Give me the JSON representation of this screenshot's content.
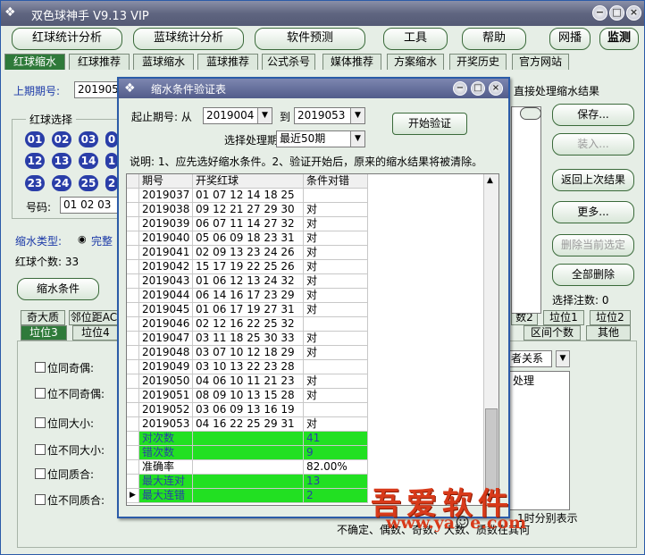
{
  "app": {
    "title": "双色球神手 V9.13 VIP"
  },
  "toolbar": [
    "红球统计分析",
    "蓝球统计分析",
    "软件预测",
    "工具",
    "帮助",
    "网播",
    "监测"
  ],
  "tabs": [
    "红球缩水",
    "红球推荐",
    "蓝球缩水",
    "蓝球推荐",
    "公式杀号",
    "媒体推荐",
    "方案缩水",
    "开奖历史",
    "官方网站"
  ],
  "main": {
    "last_period_label": "上期期号:",
    "last_period_value": "201905",
    "direct_result_label": "直接处理缩水结果",
    "red_select_label": "红球选择",
    "balls_row1": [
      "01",
      "02",
      "03",
      "0"
    ],
    "balls_row2": [
      "12",
      "13",
      "14",
      "1"
    ],
    "balls_row3": [
      "23",
      "24",
      "25",
      "2"
    ],
    "number_label": "号码:",
    "number_value": "01 02 03",
    "shrink_type_label": "缩水类型:",
    "shrink_type_value": "完整",
    "red_count_label": "红球个数: 33",
    "condition_button": "缩水条件",
    "select_count_label": "选择注数: 0",
    "right_buttons": [
      "保存...",
      "装入...",
      "返回上次结果",
      "更多...",
      "删除当前选定",
      "全部删除"
    ],
    "tabs_row1": [
      "奇大质",
      "邻位距AC"
    ],
    "tabs_row2": [
      "垃位3",
      "垃位4"
    ],
    "tabs_right_row1": [
      "数2",
      "垃位1",
      "垃位2"
    ],
    "tabs_right_row2": [
      "区间个数",
      "其他"
    ],
    "checks": [
      "位同奇偶:",
      "位不同奇偶:",
      "位同大小:",
      "位不同大小:",
      "位同质合:",
      "位不同质合:"
    ],
    "relation_value": "者关系",
    "process_label": "处理",
    "note1": "1时分别表示",
    "note2": "不确定、偶数、奇数、大数、质数在其何"
  },
  "dialog": {
    "title": "缩水条件验证表",
    "range_label": "起止期号: 从",
    "from_value": "2019004",
    "to_label": "到",
    "to_value": "2019053",
    "periods_label": "选择处理期数:",
    "periods_value": "最近50期",
    "start_button": "开始验证",
    "note": "说明: 1、应先选好缩水条件。2、验证开始后，原来的缩水结果将被清除。",
    "headers": [
      "期号",
      "开奖红球",
      "条件对错"
    ],
    "rows": [
      [
        "2019037",
        "01 07 12 14 18 25",
        ""
      ],
      [
        "2019038",
        "09 12 21 27 29 30",
        "对"
      ],
      [
        "2019039",
        "06 07 11 14 27 32",
        "对"
      ],
      [
        "2019040",
        "05 06 09 18 23 31",
        "对"
      ],
      [
        "2019041",
        "02 09 13 23 24 26",
        "对"
      ],
      [
        "2019042",
        "15 17 19 22 25 26",
        "对"
      ],
      [
        "2019043",
        "01 06 12 13 24 32",
        "对"
      ],
      [
        "2019044",
        "06 14 16 17 23 29",
        "对"
      ],
      [
        "2019045",
        "01 06 17 19 27 31",
        "对"
      ],
      [
        "2019046",
        "02 12 16 22 25 32",
        ""
      ],
      [
        "2019047",
        "03 11 18 25 30 33",
        "对"
      ],
      [
        "2019048",
        "03 07 10 12 18 29",
        "对"
      ],
      [
        "2019049",
        "03 10 13 22 23 28",
        ""
      ],
      [
        "2019050",
        "04 06 10 11 21 23",
        "对"
      ],
      [
        "2019051",
        "08 09 10 13 15 28",
        "对"
      ],
      [
        "2019052",
        "03 06 09 13 16 19",
        ""
      ],
      [
        "2019053",
        "04 16 22 25 29 31",
        "对"
      ]
    ],
    "stats": [
      {
        "label": "对次数",
        "value": "41",
        "green": true
      },
      {
        "label": "错次数",
        "value": "9",
        "green": true
      },
      {
        "label": "准确率",
        "value": "82.00%",
        "green": false
      },
      {
        "label": "最大连对",
        "value": "13",
        "green": true
      },
      {
        "label": "最大连错",
        "value": "2",
        "green": true
      }
    ]
  },
  "watermark": {
    "text": "吾爱软件",
    "url": "www.ya",
    "url2": "e.com"
  }
}
